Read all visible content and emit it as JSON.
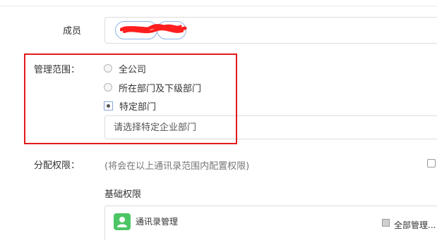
{
  "members": {
    "label": "成员"
  },
  "scope": {
    "label": "管理范围：",
    "options": [
      {
        "label": "全公司",
        "selected": false
      },
      {
        "label": "所在部门及下级部门",
        "selected": false
      },
      {
        "label": "特定部门",
        "selected": true
      }
    ],
    "dept_placeholder": "请选择特定企业部门"
  },
  "permissions": {
    "label": "分配权限：",
    "hint": "(将会在以上通讯录范围内配置权限)",
    "basic_title": "基础权限",
    "app_name": "通讯录管理",
    "all_manage_label": "全部管理..."
  },
  "colors": {
    "highlight": "#e31a1c",
    "app_icon": "#4cc565",
    "tag_border": "#8fb6e6",
    "redaction": "#ff1e1e"
  }
}
